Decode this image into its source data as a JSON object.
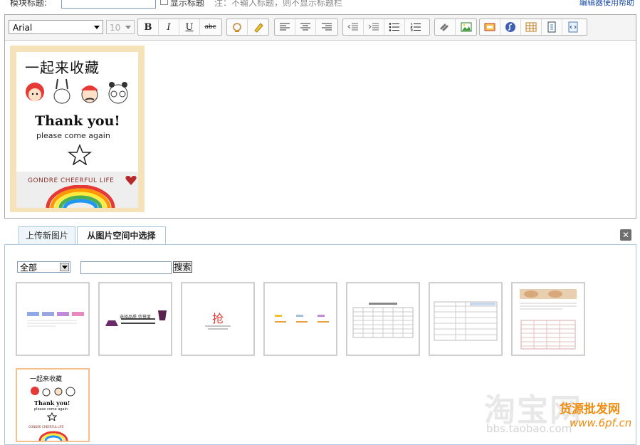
{
  "top": {
    "title_label": "模块标题:",
    "show_title_label": "显示标题",
    "note": "注：不输入标题，则不显示标题栏",
    "help_link": "编辑器使用帮助"
  },
  "toolbar": {
    "font": "Arial",
    "size": "10",
    "bold": "B",
    "italic": "I",
    "underline": "U",
    "strike": "abc"
  },
  "card": {
    "heading": "一起来收藏",
    "thanks": "Thank you!",
    "sub": "please come again",
    "brand": "GONDRE CHEERFUL LIFE"
  },
  "tabs": [
    {
      "label": "上传新图片"
    },
    {
      "label": "从图片空间中选择"
    }
  ],
  "picker": {
    "filter_value": "全部",
    "search_button": "搜索"
  },
  "thumbs": {
    "t2_text": "选择品质 信誉度",
    "t3_text": "抢"
  },
  "watermark": {
    "logo": "淘宝网",
    "site": "bbs.taobao.com",
    "brand": "货源批发网",
    "url": "www.6pf.cn"
  },
  "colors": {
    "accent_orange": "#ee8d12",
    "tab_border": "#a8c8e0",
    "selected_border": "#f5c08c"
  }
}
